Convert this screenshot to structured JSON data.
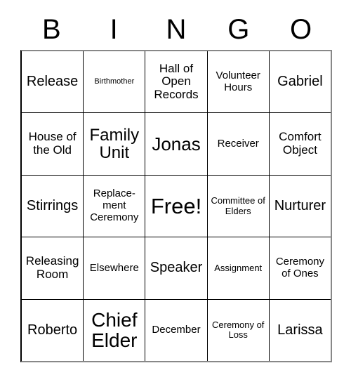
{
  "card": {
    "title": "BINGO",
    "header_letters": [
      "B",
      "I",
      "N",
      "G",
      "O"
    ],
    "grid_size": "5x5",
    "free_space_label": "Free!",
    "colors": {
      "background": "#ffffff",
      "text": "#000000",
      "grid_line": "#000000",
      "outer_frame": "#888888"
    },
    "rows": [
      {
        "cells": [
          {
            "text": "Release",
            "size": "xl"
          },
          {
            "text": "Birthmother",
            "size": "xs"
          },
          {
            "text": "Hall of Open Records",
            "size": "lg"
          },
          {
            "text": "Volunteer Hours",
            "size": "md"
          },
          {
            "text": "Gabriel",
            "size": "xl"
          }
        ]
      },
      {
        "cells": [
          {
            "text": "House of the Old",
            "size": "lg"
          },
          {
            "text": "Family Unit",
            "size": "2xl"
          },
          {
            "text": "Jonas",
            "size": "3xl"
          },
          {
            "text": "Receiver",
            "size": "md"
          },
          {
            "text": "Comfort Object",
            "size": "lg"
          }
        ]
      },
      {
        "cells": [
          {
            "text": "Stirrings",
            "size": "xl"
          },
          {
            "text": "Replace-ment Ceremony",
            "size": "md"
          },
          {
            "text": "Free!",
            "size": "free"
          },
          {
            "text": "Committee of Elders",
            "size": "sm"
          },
          {
            "text": "Nurturer",
            "size": "xl"
          }
        ]
      },
      {
        "cells": [
          {
            "text": "Releasing Room",
            "size": "lg"
          },
          {
            "text": "Elsewhere",
            "size": "md"
          },
          {
            "text": "Speaker",
            "size": "xl"
          },
          {
            "text": "Assignment",
            "size": "sm"
          },
          {
            "text": "Ceremony of Ones",
            "size": "md"
          }
        ]
      },
      {
        "cells": [
          {
            "text": "Roberto",
            "size": "xl"
          },
          {
            "text": "Chief Elder",
            "size": "4xl"
          },
          {
            "text": "December",
            "size": "md"
          },
          {
            "text": "Ceremony of Loss",
            "size": "sm"
          },
          {
            "text": "Larissa",
            "size": "xl"
          }
        ]
      }
    ]
  }
}
